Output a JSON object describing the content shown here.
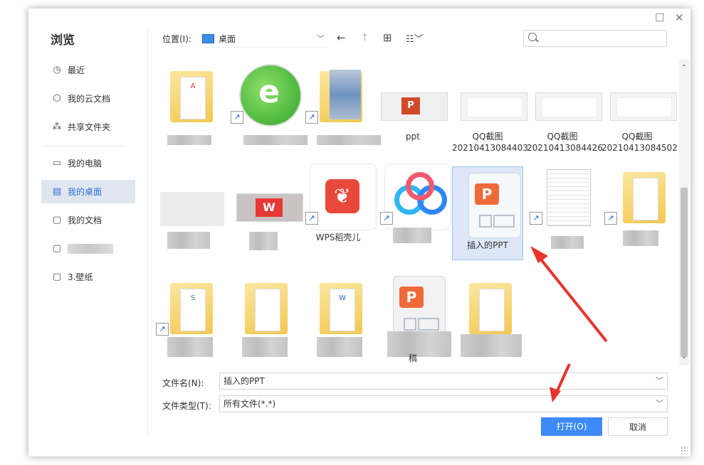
{
  "sidebar": {
    "title": "浏览",
    "items": [
      {
        "label": "最近",
        "icon": "clock-icon"
      },
      {
        "label": "我的云文档",
        "icon": "cube-icon"
      },
      {
        "label": "共享文件夹",
        "icon": "share-icon"
      },
      {
        "label": "我的电脑",
        "icon": "monitor-icon"
      },
      {
        "label": "我的桌面",
        "icon": "desktop-icon",
        "active": true
      },
      {
        "label": "我的文档",
        "icon": "folder-icon"
      },
      {
        "label": "",
        "icon": "folder-icon"
      },
      {
        "label": "3.壁纸",
        "icon": "folder-icon"
      }
    ]
  },
  "toolbar": {
    "location_label": "位置(I):",
    "location_value": "桌面"
  },
  "files": [
    {
      "name": ""
    },
    {
      "name": ""
    },
    {
      "name": ""
    },
    {
      "name": "ppt"
    },
    {
      "name": "QQ截图\n20210413084403"
    },
    {
      "name": "QQ截图\n20210413084426"
    },
    {
      "name": "QQ截图\n20210413084502"
    },
    {
      "name": ""
    },
    {
      "name": ""
    },
    {
      "name": "WPS稻壳儿"
    },
    {
      "name": ""
    },
    {
      "name": "插入的PPT"
    },
    {
      "name": ""
    },
    {
      "name": ""
    },
    {
      "name": ""
    },
    {
      "name": ""
    },
    {
      "name": ""
    },
    {
      "name": "稿"
    },
    {
      "name": ""
    }
  ],
  "form": {
    "filename_label": "文件名(N):",
    "filename_value": "插入的PPT",
    "filetype_label": "文件类型(T):",
    "filetype_value": "所有文件(*.*)",
    "open_label": "打开(O)",
    "cancel_label": "取消"
  },
  "colors": {
    "accent": "#3d8af7",
    "annotation": "#e8332e",
    "selection": "#dce8f7"
  }
}
